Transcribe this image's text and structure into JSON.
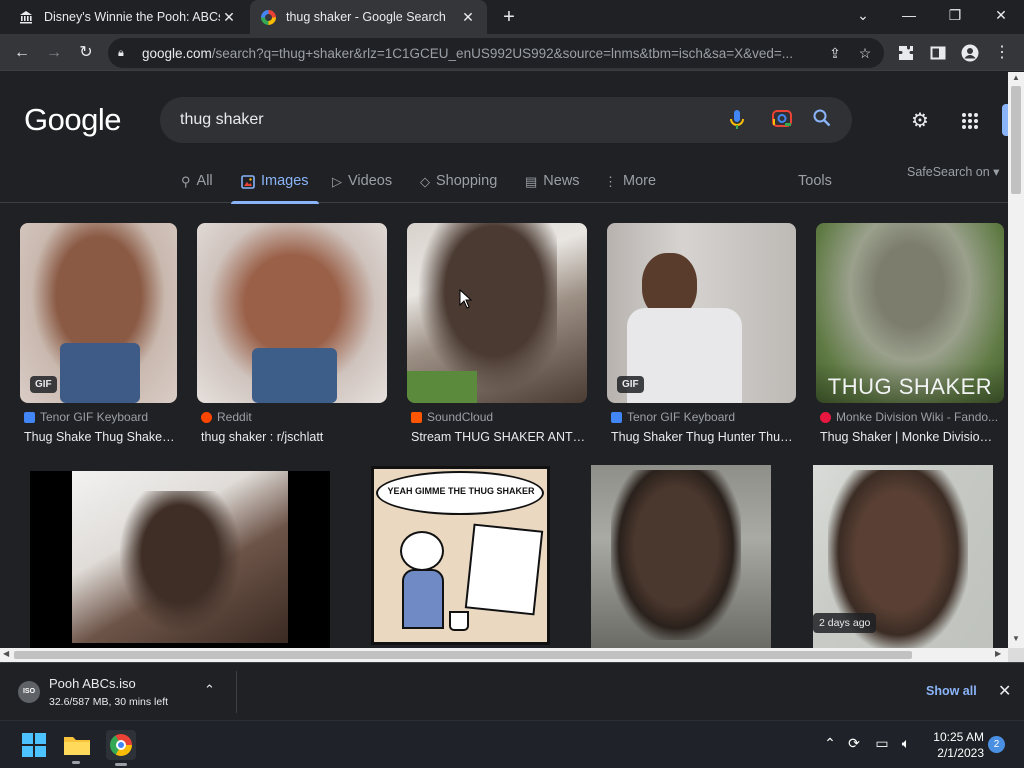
{
  "browser": {
    "tabs": [
      {
        "title": "Disney's Winnie the Pooh: ABCs s",
        "active": false
      },
      {
        "title": "thug shaker - Google Search",
        "active": true
      }
    ],
    "url_host": "google.com",
    "url_path": "/search?q=thug+shaker&rlz=1C1GCEU_enUS992US992&source=lnms&tbm=isch&sa=X&ved=..."
  },
  "search": {
    "logo": "Google",
    "query": "thug shaker"
  },
  "nav": {
    "tabs": [
      {
        "label": "All",
        "icon": "search-icon"
      },
      {
        "label": "Images",
        "icon": "image-icon",
        "active": true
      },
      {
        "label": "Videos",
        "icon": "play-icon"
      },
      {
        "label": "Shopping",
        "icon": "tag-icon"
      },
      {
        "label": "News",
        "icon": "news-icon"
      },
      {
        "label": "More",
        "icon": "more-vert-icon"
      }
    ],
    "tools": "Tools",
    "safesearch": "SafeSearch on"
  },
  "results": [
    {
      "source": "Tenor GIF Keyboard",
      "title": "Thug Shake Thug Shaker ...",
      "badge": "GIF",
      "fav_color": "#4285f4"
    },
    {
      "source": "Reddit",
      "title": "thug shaker : r/jschlatt",
      "fav_color": "#ff4500"
    },
    {
      "source": "SoundCloud",
      "title": "Stream THUG SHAKER ANTH...",
      "fav_color": "#ff5500"
    },
    {
      "source": "Tenor GIF Keyboard",
      "title": "Thug Shaker Thug Hunter Thug...",
      "badge": "GIF",
      "fav_color": "#4285f4"
    },
    {
      "source": "Monke Division Wiki - Fando...",
      "title": "Thug Shaker | Monke Division ...",
      "overlay": "THUG SHAKER",
      "fav_color": "#e8173f"
    }
  ],
  "row2": {
    "comic_text": "YEAH GIMME THE THUG SHAKER",
    "age_badge": "2 days ago"
  },
  "download": {
    "filename": "Pooh ABCs.iso",
    "status": "32.6/587 MB, 30 mins left",
    "show_all": "Show all"
  },
  "taskbar": {
    "time": "10:25 AM",
    "date": "2/1/2023",
    "notifications": "2"
  }
}
